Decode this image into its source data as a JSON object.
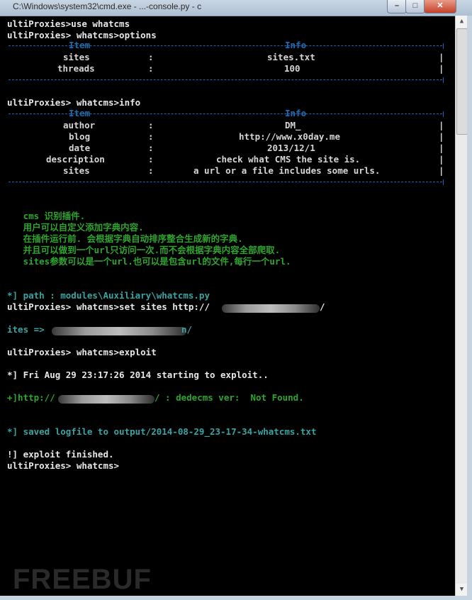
{
  "window": {
    "title": "C:\\Windows\\system32\\cmd.exe - ...-console.py - c",
    "btn_min": "–",
    "btn_max": "□",
    "btn_close": "✕"
  },
  "console": {
    "cmd_use": "ultiProxies>use whatcms",
    "cmd_options": "ultiProxies> whatcms>options",
    "options_table": {
      "col_item": "Item",
      "col_info": "Info",
      "rows": [
        {
          "item": "sites",
          "colon": ":",
          "info": "sites.txt"
        },
        {
          "item": "threads",
          "colon": ":",
          "info": "100"
        }
      ]
    },
    "cmd_info": "ultiProxies> whatcms>info",
    "info_table": {
      "col_item": "Item",
      "col_info": "Info",
      "rows": [
        {
          "item": "author",
          "colon": ":",
          "info": "DM_"
        },
        {
          "item": "blog",
          "colon": ":",
          "info": "http://www.x0day.me"
        },
        {
          "item": "date",
          "colon": ":",
          "info": "2013/12/1"
        },
        {
          "item": "description",
          "colon": ":",
          "info": "check what CMS the site is."
        },
        {
          "item": "sites",
          "colon": ":",
          "info": "a url or a file includes some urls."
        }
      ]
    },
    "desc_lines": [
      "   cms 识别插件.",
      "   用户可以自定义添加字典内容.",
      "   在插件运行前. 会根据字典自动排序整合生成新的字典.",
      "   并且可以做到一个url只访问一次.而不会根据字典内容全部爬取.",
      "   sites参数可以是一个url.也可以是包含url的文件,每行一个url."
    ],
    "path_line": "*] path : modules\\Auxiliary\\whatcms.py",
    "cmd_set": "ultiProxies> whatcms>set sites http://",
    "cmd_set_tail": "/",
    "sites_line": "ites => ",
    "sites_tail": "n/",
    "cmd_exploit": "ultiProxies> whatcms>exploit",
    "start_line": "*] Fri Aug 29 23:17:26 2014 starting to exploit..",
    "result_prefix": "+]http://",
    "result_suffix": "/ : dedecms ver:  Not Found.",
    "saved_line": "*] saved logfile to output/2014-08-29_23-17-34-whatcms.txt",
    "finished_line": "!] exploit finished.",
    "prompt": "ultiProxies> whatcms>"
  },
  "watermark": "FREEBUF"
}
